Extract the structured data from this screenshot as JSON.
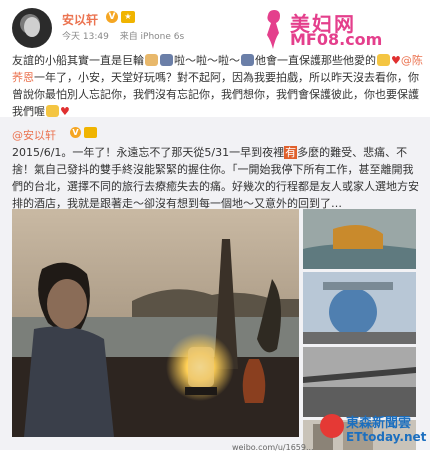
{
  "post": {
    "author": "安以轩",
    "verified_badge": "V",
    "time": "今天 13:49",
    "source": "来自 iPhone 6s",
    "text_before": "友誼的小船其實一直是巨輪",
    "text_mid1": "啦～啦～啦～",
    "text_mid2": "他會一直保護那些他愛的",
    "text_mid3": "一年了，小安，天堂好玩嗎？對不起阿，因為我要拍戲，所以昨天沒去看你，你曾說你最怕別人忘記你，我們沒有忘記你，我們想你，我們會保護彼此，你也要保護我們喔",
    "mention": "@陈荞恩"
  },
  "watermark_top": {
    "cn": "美妇网",
    "en": "MF08.com"
  },
  "repost": {
    "author": "@安以轩",
    "text_a": "2015/6/1。一年了！永遠忘不了那天從5/31一早到夜裡",
    "highlight": "有",
    "text_b": "多麼的難受、悲痛、不捨！氣自己發抖的雙手終沒能緊緊的握住你。「一開始我停下所有工作，甚至離開我們的台北，選擇不同的旅行去療癒失去的痛。好幾次的行程都是友人或家人選地方安排的酒店，我就是跟著走～卻沒有想到每一個地～又意外的回到了…"
  },
  "image_caption": "weibo.com/u/1659...",
  "watermark_bottom": {
    "cn": "東森新聞雲",
    "en": "ETtoday.net"
  },
  "colors": {
    "accent": "#eb7350",
    "watermark_pink": "#e43f8c",
    "repost_bg": "#f2f2f5"
  }
}
